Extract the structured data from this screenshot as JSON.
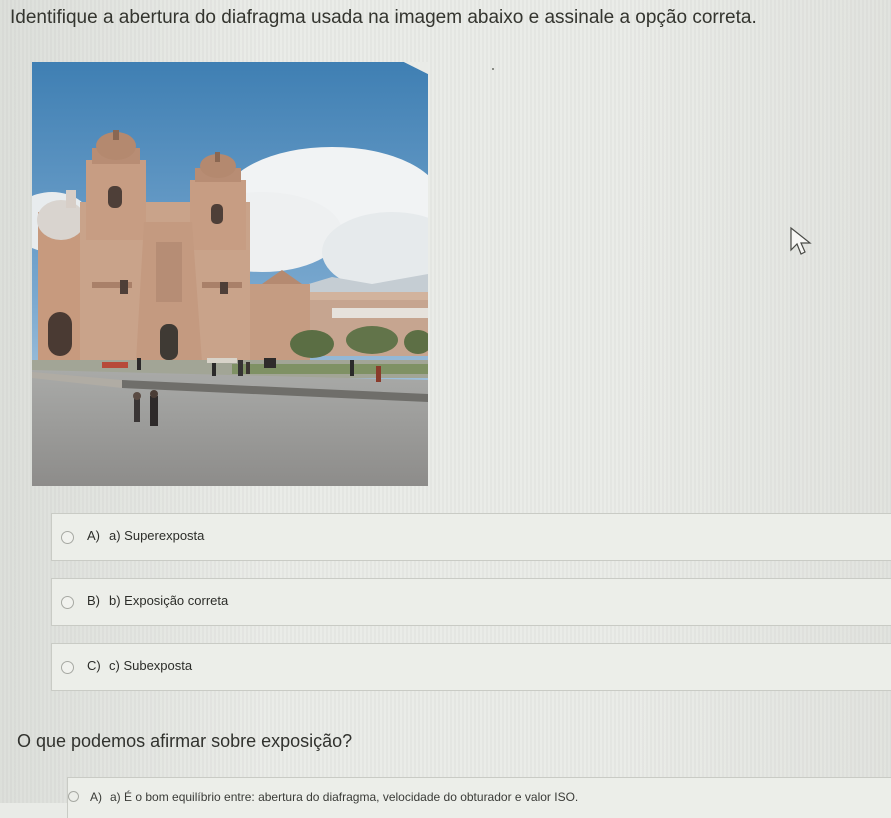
{
  "question1": {
    "title": "Identifique a abertura do diafragma usada na imagem abaixo e assinale a opção correta.",
    "image_icon": "photo-cathedral-plaza",
    "options": [
      {
        "letter": "A)",
        "text": "a) Superexposta"
      },
      {
        "letter": "B)",
        "text": "b) Exposição correta"
      },
      {
        "letter": "C)",
        "text": "c) Subexposta"
      }
    ]
  },
  "question2": {
    "title": "O que podemos afirmar sobre exposição?",
    "options": [
      {
        "letter": "A)",
        "text": "a) É o bom equilíbrio entre: abertura do diafragma, velocidade do obturador e valor ISO."
      }
    ]
  },
  "cursor_icon": "arrow-pointer-icon",
  "colors": {
    "background": "#e9ebe7",
    "text": "#2f302c",
    "border": "#c9cbc5"
  }
}
